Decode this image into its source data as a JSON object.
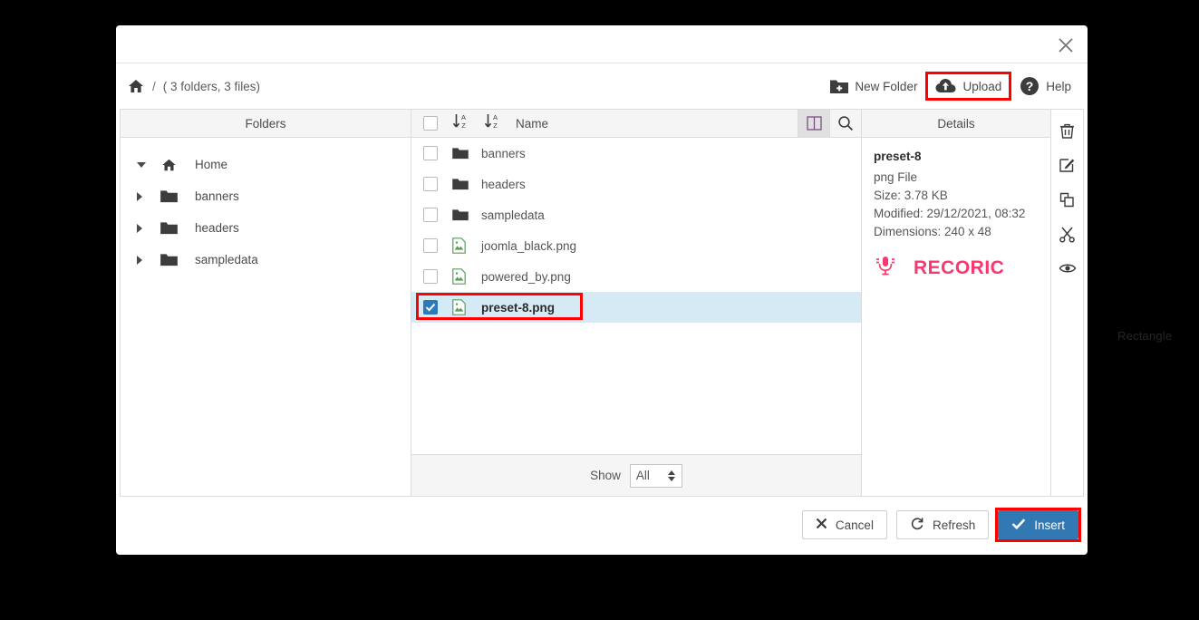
{
  "backdrop": {
    "label": "Rectangle"
  },
  "dialog": {
    "close_icon": "close-icon",
    "breadcrumb": {
      "home_icon": "home-icon",
      "separator": "/",
      "info": "( 3 folders, 3 files)"
    },
    "toolbar": [
      {
        "label": "New Folder",
        "icon": "new-folder-icon",
        "highlighted": false
      },
      {
        "label": "Upload",
        "icon": "upload-cloud-icon",
        "highlighted": true
      },
      {
        "label": "Help",
        "icon": "help-question-icon",
        "highlighted": false
      }
    ],
    "folders_pane": {
      "header": "Folders",
      "tree": [
        {
          "label": "Home",
          "icon": "home-icon",
          "expanded": true
        },
        {
          "label": "banners",
          "icon": "folder-icon",
          "expanded": false
        },
        {
          "label": "headers",
          "icon": "folder-icon",
          "expanded": false
        },
        {
          "label": "sampledata",
          "icon": "folder-icon",
          "expanded": false
        }
      ]
    },
    "files_pane": {
      "header": {
        "select_all_checked": false,
        "sort_asc_icon": "sort-alpha-asc-icon",
        "sort_desc_icon": "sort-alpha-desc-icon",
        "name_column": "Name",
        "view_toggle_icon": "split-view-icon",
        "search_icon": "search-icon"
      },
      "rows": [
        {
          "name": "banners",
          "type": "folder",
          "checked": false,
          "selected": false
        },
        {
          "name": "headers",
          "type": "folder",
          "checked": false,
          "selected": false
        },
        {
          "name": "sampledata",
          "type": "folder",
          "checked": false,
          "selected": false
        },
        {
          "name": "joomla_black.png",
          "type": "image",
          "checked": false,
          "selected": false
        },
        {
          "name": "powered_by.png",
          "type": "image",
          "checked": false,
          "selected": false
        },
        {
          "name": "preset-8.png",
          "type": "image",
          "checked": true,
          "selected": true
        }
      ],
      "show_bar": {
        "label": "Show",
        "value": "All"
      }
    },
    "details_pane": {
      "header": "Details",
      "title": "preset-8",
      "file_type": "png File",
      "size": "Size: 3.78 KB",
      "modified": "Modified: 29/12/2021, 08:32",
      "dimensions": "Dimensions: 240 x 48",
      "thumbnail": {
        "icon": "microphone-icon",
        "brand_text": "RECORIC",
        "brand_color": "#f8386e"
      }
    },
    "actions_pane": [
      {
        "icon": "trash-icon"
      },
      {
        "icon": "edit-icon"
      },
      {
        "icon": "copy-icon"
      },
      {
        "icon": "cut-scissors-icon"
      },
      {
        "icon": "eye-preview-icon"
      }
    ],
    "footer": {
      "cancel": {
        "label": "Cancel",
        "icon": "x-icon"
      },
      "refresh": {
        "label": "Refresh",
        "icon": "refresh-icon"
      },
      "insert": {
        "label": "Insert",
        "icon": "check-icon",
        "highlighted": true,
        "color": "#3279b4"
      }
    }
  }
}
